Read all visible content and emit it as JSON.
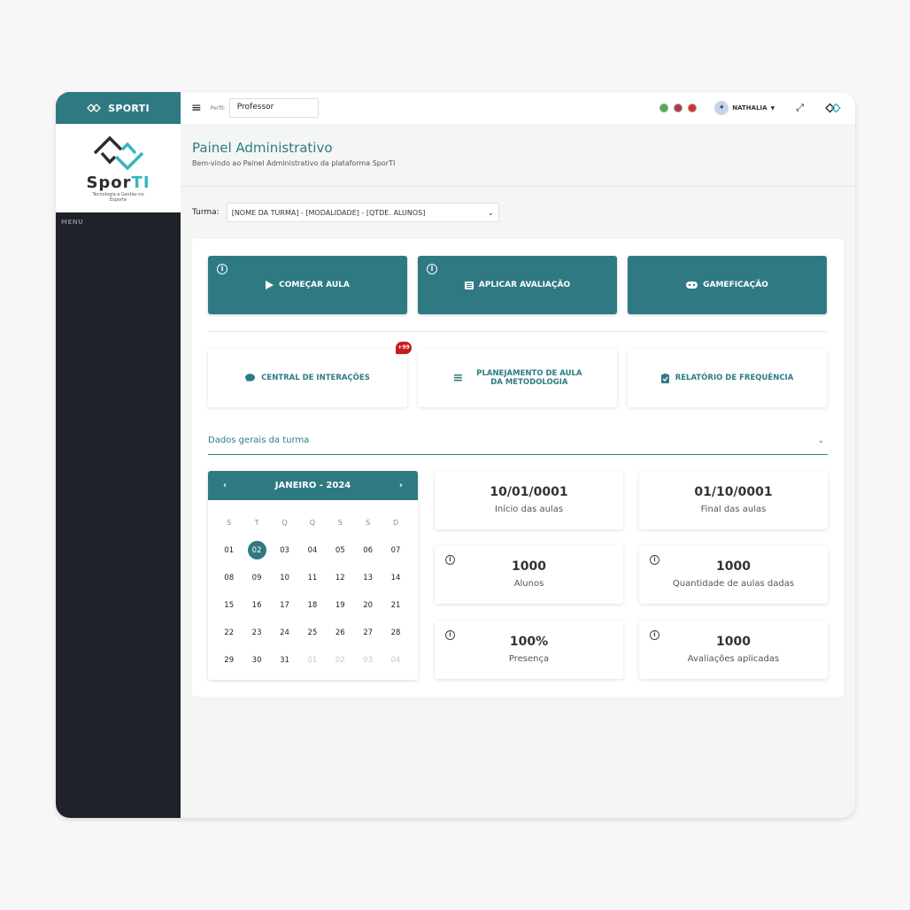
{
  "sidebar": {
    "top_title": "SPORTI",
    "logo_brand_a": "Spor",
    "logo_brand_b": "TI",
    "logo_tag": "Tecnologia e Gestão no Esporte",
    "menu_label": "MENU"
  },
  "topbar": {
    "perfil_label": "Perfil:",
    "perfil_value": "Professor",
    "user_name": "NATHALIA",
    "flags": [
      "#4caf50",
      "#b03a48",
      "#d9322b"
    ]
  },
  "header": {
    "title": "Painel Administrativo",
    "subtitle": "Bem-vindo ao Painel Administrativo da plataforma SporTI"
  },
  "turma": {
    "label": "Turma:",
    "value": "[NOME DA TURMA] - [MODALIDADE] - [QTDE. ALUNOS]"
  },
  "actions": {
    "comecar_aula": "COMEÇAR AULA",
    "aplicar_avaliacao": "APLICAR AVALIAÇÃO",
    "gameficacao": "GAMEFICAÇÃO",
    "central_interacoes": "CENTRAL DE INTERAÇÕES",
    "central_badge": "+99",
    "planejamento_l1": "PLANEJAMENTO DE AULA",
    "planejamento_l2": "DA METODOLOGIA",
    "relatorio": "RELATÓRIO DE FREQUÊNCIA"
  },
  "accordion": {
    "title": "Dados gerais da turma"
  },
  "calendar": {
    "title": "JANEIRO - 2024",
    "weekdays": [
      "S",
      "T",
      "Q",
      "Q",
      "S",
      "S",
      "D"
    ],
    "days": [
      "01",
      "02",
      "03",
      "04",
      "05",
      "06",
      "07",
      "08",
      "09",
      "10",
      "11",
      "12",
      "13",
      "14",
      "15",
      "16",
      "17",
      "18",
      "19",
      "20",
      "21",
      "22",
      "23",
      "24",
      "25",
      "26",
      "27",
      "28",
      "29",
      "30",
      "31",
      "01",
      "02",
      "03",
      "04"
    ],
    "selected_index": 1,
    "muted_from_index": 31
  },
  "stats": {
    "inicio": {
      "value": "10/01/0001",
      "label": "Início das aulas"
    },
    "final": {
      "value": "01/10/0001",
      "label": "Final das aulas"
    },
    "alunos": {
      "value": "1000",
      "label": "Alunos"
    },
    "aulas_dadas": {
      "value": "1000",
      "label": "Quantidade de aulas dadas"
    },
    "presenca": {
      "value": "100%",
      "label": "Presença"
    },
    "avaliacoes": {
      "value": "1000",
      "label": "Avaliações aplicadas"
    }
  },
  "colors": {
    "accent": "#2f7a82",
    "sidebar": "#1f2329",
    "badge": "#c51d1d"
  },
  "icons": [
    "logo-icon",
    "hamburger-icon",
    "play-icon",
    "list-icon",
    "gamepad-icon",
    "chat-icon",
    "menu-lines-icon",
    "clipboard-check-icon",
    "chevron-down-icon",
    "chevron-left-icon",
    "chevron-right-icon",
    "info-icon",
    "expand-icon"
  ]
}
